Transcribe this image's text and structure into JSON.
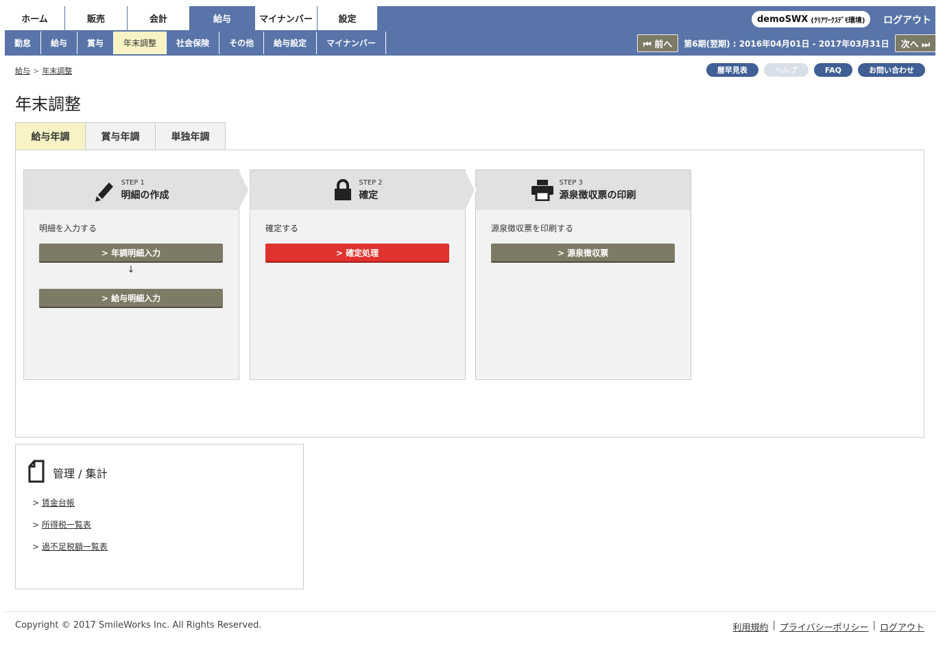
{
  "main_tabs": [
    "ホーム",
    "販売",
    "会計",
    "給与",
    "マイナンバー",
    "設定"
  ],
  "user": {
    "name": "demoSWX",
    "env": "(ｸﾘｱﾜｰｸｽﾃﾞﾓ環境)"
  },
  "logout_top": "ログアウト",
  "sub_tabs": [
    "勤怠",
    "給与",
    "賞与",
    "年末調整",
    "社会保険",
    "その他",
    "給与設定",
    "マイナンバー"
  ],
  "period": {
    "prev": "⏮ 前へ",
    "text": "第6期(翌期) : 2016年04月01日 - 2017年03月31日",
    "next": "次へ ⏭"
  },
  "breadcrumb": {
    "parent": "給与",
    "sep": ">",
    "current": "年末調整"
  },
  "help_links": [
    "暦早見表",
    "ヘルプ",
    "FAQ",
    "お問い合わせ"
  ],
  "page_title": "年末調整",
  "ye_tabs": [
    "給与年調",
    "賞与年調",
    "単独年調"
  ],
  "steps": [
    {
      "num": "STEP 1",
      "name": "明細の作成",
      "desc": "明細を入力する",
      "btn1": "> 年調明細入力",
      "arrow": "↓",
      "btn2": "> 給与明細入力"
    },
    {
      "num": "STEP 2",
      "name": "確定",
      "desc": "確定する",
      "btn1": "> 確定処理"
    },
    {
      "num": "STEP 3",
      "name": "源泉徴収票の印刷",
      "desc": "源泉徴収票を印刷する",
      "btn1": "> 源泉徴収票"
    }
  ],
  "mgmt": {
    "title": "管理 / 集計",
    "items": [
      "賃金台帳",
      "所得税一覧表",
      "過不足税額一覧表"
    ],
    "prefix": ">"
  },
  "footer": {
    "copyright": "Copyright © 2017 SmileWorks Inc. All Rights Reserved.",
    "links": [
      "利用規約",
      "プライバシーポリシー",
      "ログアウト"
    ],
    "sep": "|"
  },
  "colors": {
    "header": "#5874a8",
    "highlight": "#f8f3c4",
    "olive_btn": "#7d7a66",
    "red_btn": "#e0322e",
    "pill": "#3f5f95"
  }
}
